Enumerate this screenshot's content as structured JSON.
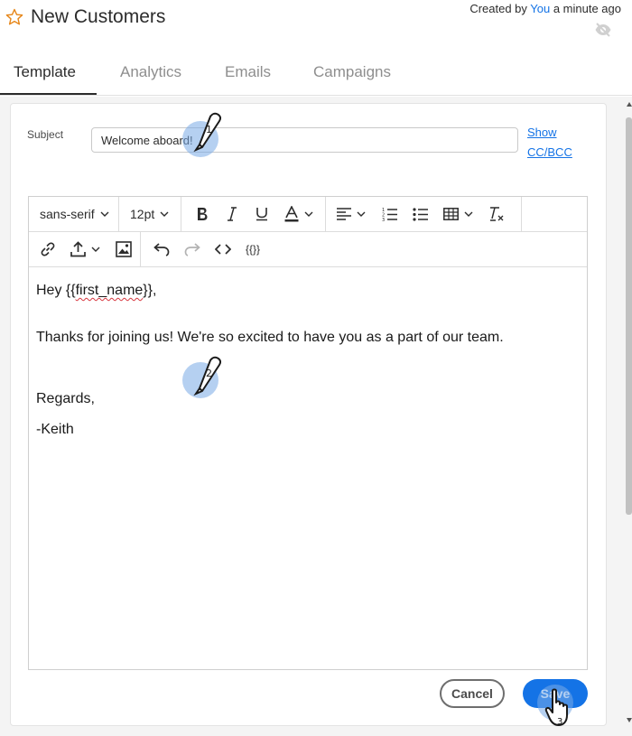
{
  "header": {
    "title": "New Customers",
    "meta_prefix": "Created by ",
    "meta_user": "You",
    "meta_suffix": " a minute ago"
  },
  "tabs": [
    {
      "label": "Template",
      "active": true
    },
    {
      "label": "Analytics",
      "active": false
    },
    {
      "label": "Emails",
      "active": false
    },
    {
      "label": "Campaigns",
      "active": false
    }
  ],
  "subject": {
    "label": "Subject",
    "value": "Welcome aboard!",
    "show_cc_line1": "Show",
    "show_cc_line2": "CC/BCC"
  },
  "toolbar": {
    "font_family": "sans-serif",
    "font_size": "12pt",
    "token_label": "{{}}"
  },
  "body": {
    "greeting_prefix": "Hey {{",
    "greeting_token": "first_name",
    "greeting_suffix": "}},",
    "line_thanks": "Thanks for joining us! We're so excited to have you as a part of our team.",
    "line_regards": "Regards,",
    "line_signature": "-Keith"
  },
  "buttons": {
    "cancel": "Cancel",
    "save": "Save"
  },
  "markers": [
    "1",
    "2",
    "3"
  ],
  "colors": {
    "accent": "#1473e6",
    "marker": "#78aae6"
  }
}
